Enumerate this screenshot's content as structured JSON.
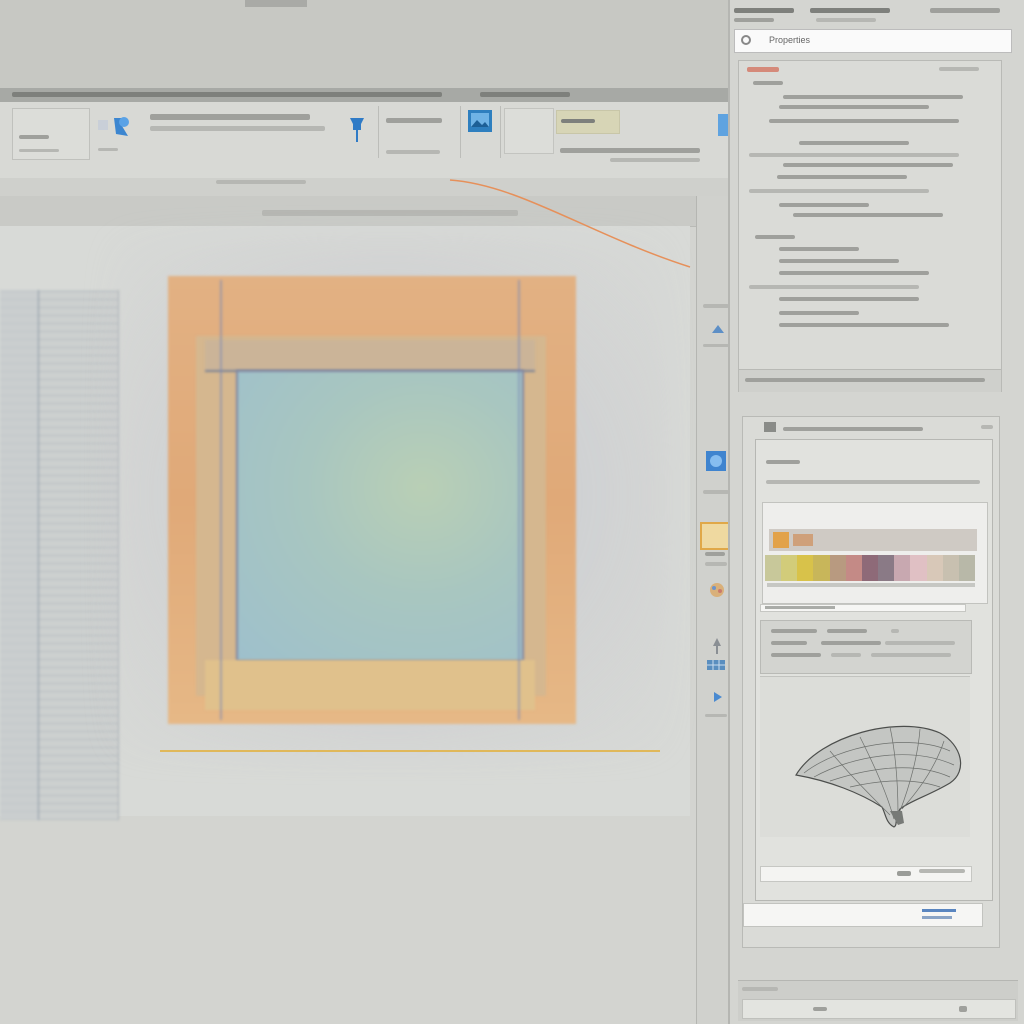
{
  "right_panel": {
    "search_value": "Properties"
  },
  "swatches": [
    "#c8c89a",
    "#d2cc7a",
    "#d8c24a",
    "#c8b65a",
    "#b89a80",
    "#c48a86",
    "#8e6a78",
    "#8a7a86",
    "#c8a8b0",
    "#e0c0c4",
    "#d8c8b8",
    "#c8c0b0",
    "#b8b8a8"
  ],
  "accent": "#e2a24a",
  "highlight": "#4a8ad0"
}
